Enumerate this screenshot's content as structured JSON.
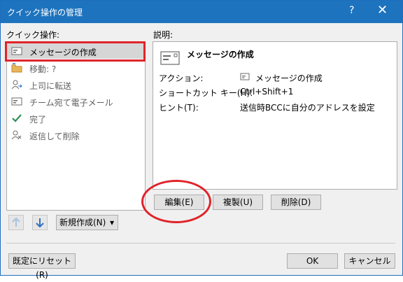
{
  "window": {
    "title": "クイック操作の管理",
    "help_glyph": "?",
    "close_glyph": "✕"
  },
  "quick_steps": {
    "label": "クイック操作:",
    "items": [
      {
        "label": "メッセージの作成",
        "icon": "new-mail-icon",
        "selected": true
      },
      {
        "label": "移動: ?",
        "icon": "folder-move-icon"
      },
      {
        "label": "上司に転送",
        "icon": "forward-person-icon"
      },
      {
        "label": "チーム宛て電子メール",
        "icon": "team-mail-icon"
      },
      {
        "label": "完了",
        "icon": "checkmark-icon"
      },
      {
        "label": "返信して削除",
        "icon": "reply-delete-icon"
      }
    ]
  },
  "description": {
    "label": "説明:",
    "title": "メッセージの作成",
    "rows": [
      {
        "label": "アクション:",
        "value": "メッセージの作成"
      },
      {
        "label": "ショートカット キー(H):",
        "value": "Ctrl+Shift+1"
      },
      {
        "label": "ヒント(T):",
        "value": "送信時BCCに自分のアドレスを設定"
      }
    ]
  },
  "actions": {
    "edit": "編集(E)",
    "copy": "複製(U)",
    "delete": "削除(D)",
    "new": "新規作成(N)"
  },
  "footer": {
    "reset": "既定にリセット(R)",
    "ok": "OK",
    "cancel": "キャンセル"
  },
  "colors": {
    "titlebar": "#1e73be",
    "highlight": "#e0242a",
    "selected_row": "#d6d6d6",
    "check": "#2f8f57"
  }
}
